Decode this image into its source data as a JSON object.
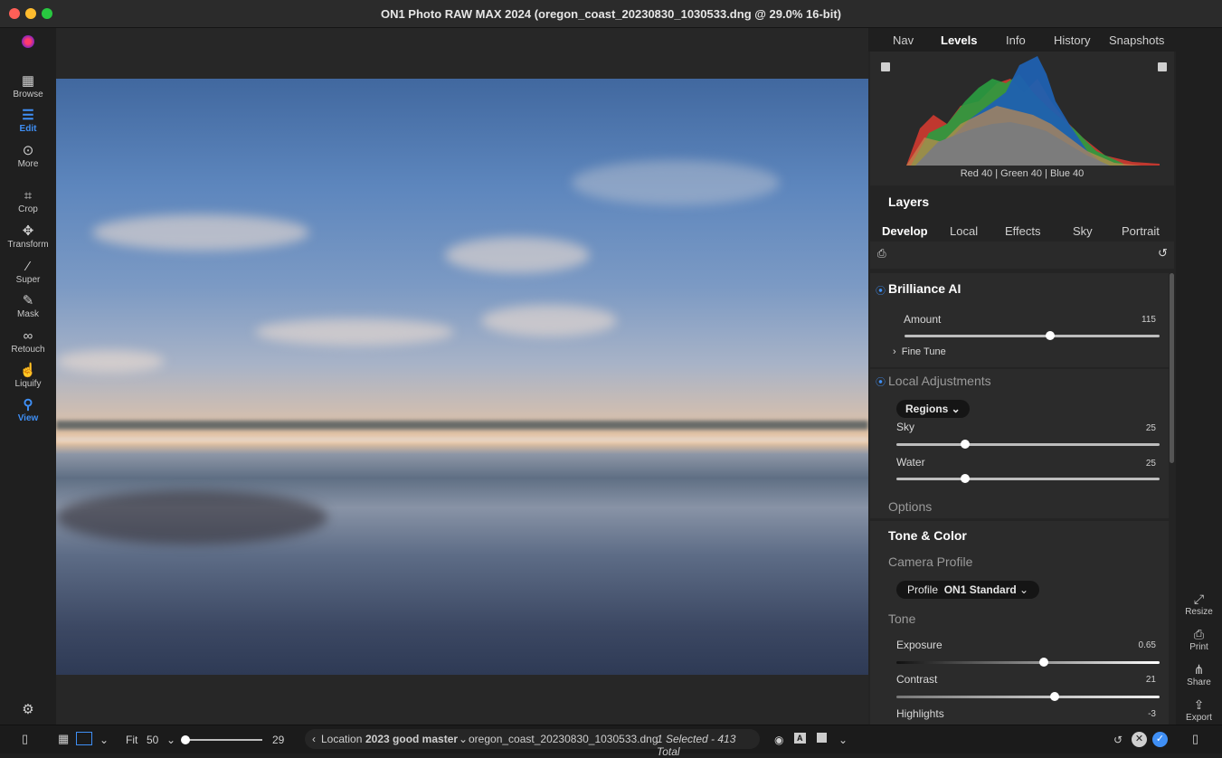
{
  "window": {
    "title": "ON1 Photo RAW MAX 2024 (oregon_coast_20230830_1030533.dng @ 29.0% 16-bit)"
  },
  "left_tools": [
    {
      "label": "Browse",
      "icon": "browse-icon"
    },
    {
      "label": "Edit",
      "icon": "edit-icon",
      "active": true
    },
    {
      "label": "More",
      "icon": "more-icon"
    },
    {
      "label": "Crop",
      "icon": "crop-icon"
    },
    {
      "label": "Transform",
      "icon": "transform-icon"
    },
    {
      "label": "Super",
      "icon": "super-icon"
    },
    {
      "label": "Mask",
      "icon": "mask-icon"
    },
    {
      "label": "Retouch",
      "icon": "retouch-icon"
    },
    {
      "label": "Liquify",
      "icon": "liquify-icon"
    },
    {
      "label": "View",
      "icon": "view-icon",
      "active": true
    }
  ],
  "top_tabs": [
    "Nav",
    "Levels",
    "Info",
    "History",
    "Snapshots"
  ],
  "active_top_tab": "Levels",
  "histogram": {
    "label": "Red 40 | Green 40 | Blue 40"
  },
  "layers": {
    "title": "Layers"
  },
  "sub_tabs": [
    "Develop",
    "Local",
    "Effects",
    "Sky",
    "Portrait"
  ],
  "active_sub_tab": "Develop",
  "brilliance": {
    "title": "Brilliance AI",
    "amount_label": "Amount",
    "amount_value": "115",
    "amount_level": 0.57,
    "fine_tune": "Fine Tune"
  },
  "local_adjustments": {
    "title": "Local Adjustments",
    "regions": "Regions",
    "sky_label": "Sky",
    "sky_value": "25",
    "sky_level": 0.26,
    "water_label": "Water",
    "water_value": "25",
    "water_level": 0.26,
    "options": "Options"
  },
  "tone_color": {
    "title": "Tone & Color",
    "camera_profile": "Camera Profile",
    "profile_label": "Profile",
    "profile_value": "ON1 Standard",
    "tone": "Tone",
    "exposure_label": "Exposure",
    "exposure_value": "0.65",
    "exposure_level": 0.56,
    "contrast_label": "Contrast",
    "contrast_value": "21",
    "contrast_level": 0.6,
    "highlights_label": "Highlights",
    "highlights_value": "-3"
  },
  "right_side": [
    {
      "label": "Resize",
      "icon": "resize-icon"
    },
    {
      "label": "Print",
      "icon": "print-icon"
    },
    {
      "label": "Share",
      "icon": "share-icon"
    },
    {
      "label": "Export",
      "icon": "export-icon"
    }
  ],
  "bottom": {
    "fit": "Fit",
    "zoom": "50",
    "thumb_size": "29",
    "location_prefix": "Location",
    "folder": "2023 good master",
    "filename": "oregon_coast_20230830_1030533.dng",
    "selection": "1 Selected - 413 Total"
  },
  "colors": {
    "accent": "#3f8ff5",
    "panel": "#242424",
    "background": "#1f1f1f"
  }
}
